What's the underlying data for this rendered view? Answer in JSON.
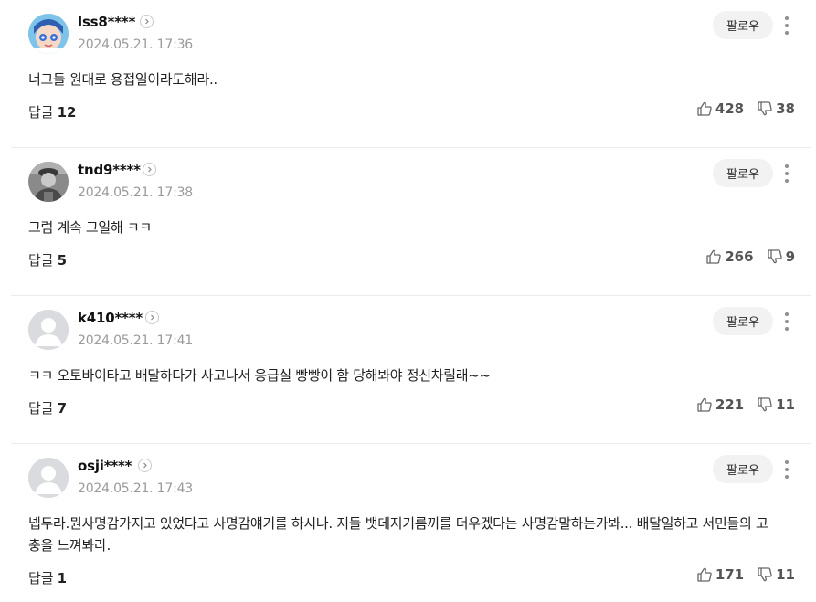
{
  "comments": [
    {
      "username": "lss8****",
      "date": "2024.05.21. 17:36",
      "text": "너그들 원대로 용접일이라도해라..",
      "reply_label": "답글",
      "reply_count": "12",
      "likes": "428",
      "dislikes": "38",
      "follow_label": "팔로우",
      "avatar": "cartoon-avatar"
    },
    {
      "username": "tnd9****",
      "date": "2024.05.21. 17:38",
      "text": "그럼 계속 그일해 ㅋㅋ",
      "reply_label": "답글",
      "reply_count": "5",
      "likes": "266",
      "dislikes": "9",
      "follow_label": "팔로우",
      "avatar": "photo-avatar"
    },
    {
      "username": "k410****",
      "date": "2024.05.21. 17:41",
      "text": "ㅋㅋ 오토바이타고 배달하다가 사고나서 응급실 빵빵이 함 당해봐야 정신차릴래~~",
      "reply_label": "답글",
      "reply_count": "7",
      "likes": "221",
      "dislikes": "11",
      "follow_label": "팔로우",
      "avatar": "default-avatar"
    },
    {
      "username": "osji****",
      "date": "2024.05.21. 17:43",
      "text": "넵두라.뭔사명감가지고 있었다고 사명감얘기를 하시나. 지들 뱃데지기름끼를 더우겠다는 사명감말하는가봐... 배달일하고 서민들의 고충을 느껴봐라.",
      "reply_label": "답글",
      "reply_count": "1",
      "likes": "171",
      "dislikes": "11",
      "follow_label": "팔로우",
      "avatar": "default-avatar"
    }
  ],
  "colors": {
    "divider": "#ebebeb",
    "date": "#9a9a9a",
    "follow_bg": "#f2f2f2"
  }
}
